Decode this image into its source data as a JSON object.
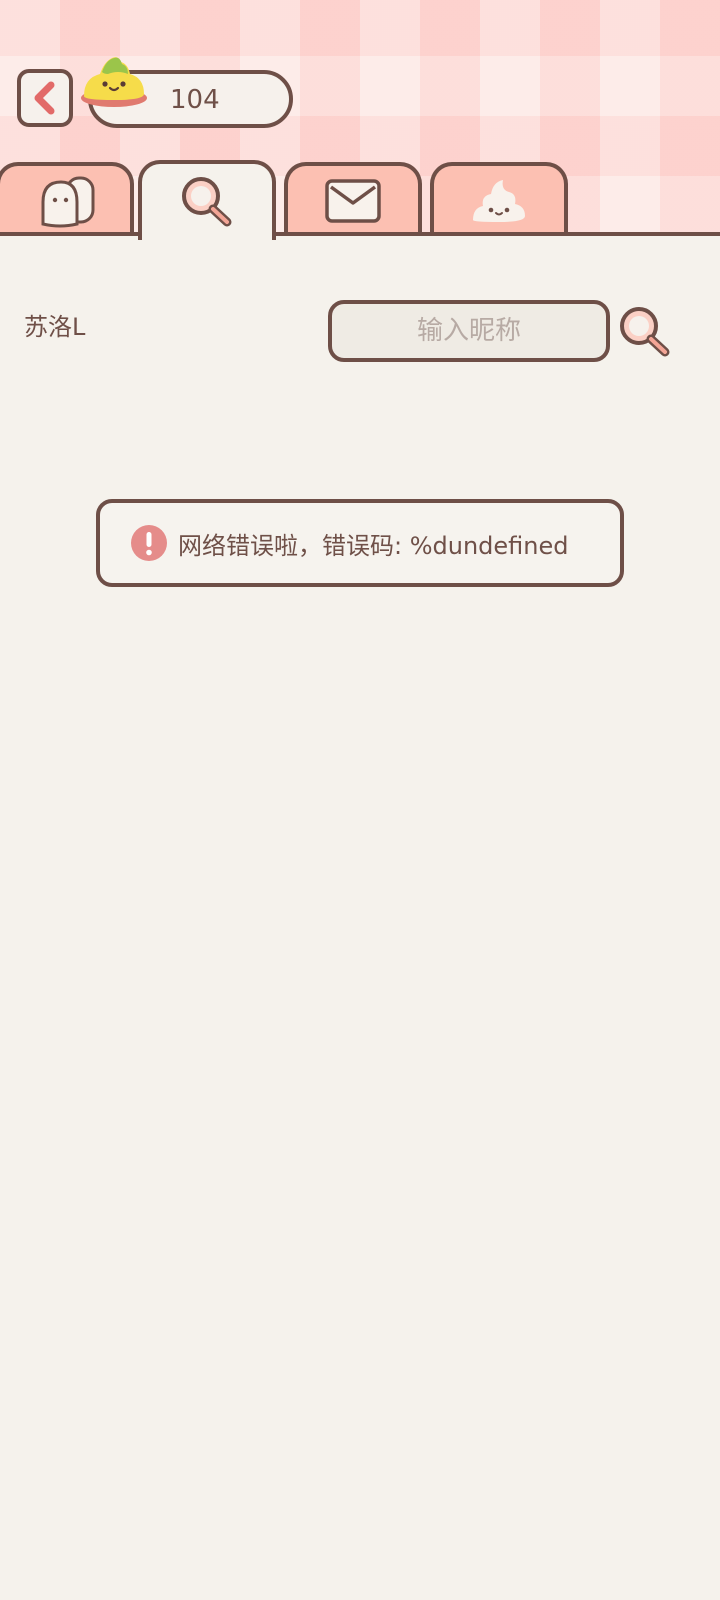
{
  "header": {
    "back_icon": "chevron-left-icon",
    "coins": {
      "count": "104",
      "mascot_icon": "slime-mascot-icon"
    }
  },
  "tabs": [
    {
      "id": "friends",
      "icon": "friends-icon",
      "active": false
    },
    {
      "id": "search",
      "icon": "search-icon",
      "active": true
    },
    {
      "id": "mail",
      "icon": "mail-icon",
      "active": false
    },
    {
      "id": "poop",
      "icon": "poop-icon",
      "active": false
    }
  ],
  "search": {
    "username": "苏洛L",
    "placeholder": "输入昵称",
    "value": "",
    "button_icon": "search-icon"
  },
  "error": {
    "icon": "alert-icon",
    "message": "网络错误啦，错误码: %dundefined"
  },
  "colors": {
    "outline": "#6e4f47",
    "tab_fill": "#fcc0b2",
    "page_background": "#f5f2ec",
    "header_background": "#fde0db",
    "accent_red": "#e26a68",
    "alert_fill": "#e58c8a"
  }
}
